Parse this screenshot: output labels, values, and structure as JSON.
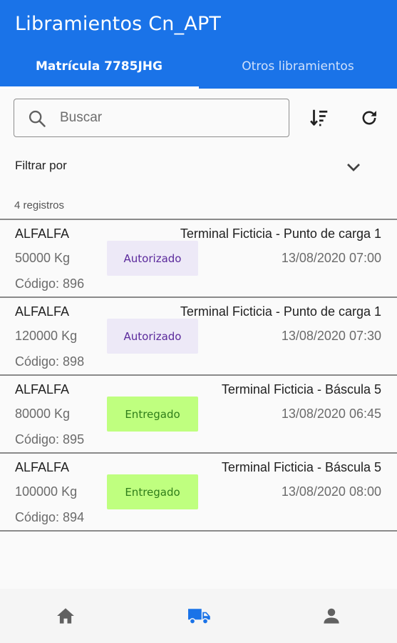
{
  "app": {
    "title": "Libramientos Cn_APT"
  },
  "tabs": [
    {
      "label": "Matrícula 7785JHG",
      "active": true
    },
    {
      "label": "Otros libramientos",
      "active": false
    }
  ],
  "search": {
    "placeholder": "Buscar",
    "value": ""
  },
  "toolbar": {
    "sort_icon": "sort-descending-icon",
    "refresh_icon": "refresh-icon"
  },
  "filter": {
    "label": "Filtrar por",
    "icon": "chevron-down-icon"
  },
  "records": {
    "count_label": "4 registros",
    "items": [
      {
        "product": "ALFALFA",
        "weight": "50000 Kg",
        "code": "Código: 896",
        "status": "Autorizado",
        "status_type": "authorized",
        "place": "Terminal Ficticia - Punto de carga 1",
        "datetime": "13/08/2020 07:00"
      },
      {
        "product": "ALFALFA",
        "weight": "120000 Kg",
        "code": "Código: 898",
        "status": "Autorizado",
        "status_type": "authorized",
        "place": "Terminal Ficticia - Punto de carga 1",
        "datetime": "13/08/2020 07:30"
      },
      {
        "product": "ALFALFA",
        "weight": "80000 Kg",
        "code": "Código: 895",
        "status": "Entregado",
        "status_type": "delivered",
        "place": "Terminal Ficticia - Báscula 5",
        "datetime": "13/08/2020 06:45"
      },
      {
        "product": "ALFALFA",
        "weight": "100000 Kg",
        "code": "Código: 894",
        "status": "Entregado",
        "status_type": "delivered",
        "place": "Terminal Ficticia - Báscula 5",
        "datetime": "13/08/2020 08:00"
      }
    ]
  },
  "bottom_nav": [
    {
      "icon": "home-icon",
      "active": false
    },
    {
      "icon": "truck-icon",
      "active": true
    },
    {
      "icon": "person-icon",
      "active": false
    }
  ],
  "colors": {
    "primary": "#1a73e8",
    "authorized_bg": "#ede9f7",
    "authorized_text": "#5b2a9c",
    "delivered_bg": "#bfff7f",
    "delivered_text": "#2f7d1a",
    "nav_active": "#1a73e8",
    "nav_inactive": "#616161"
  }
}
